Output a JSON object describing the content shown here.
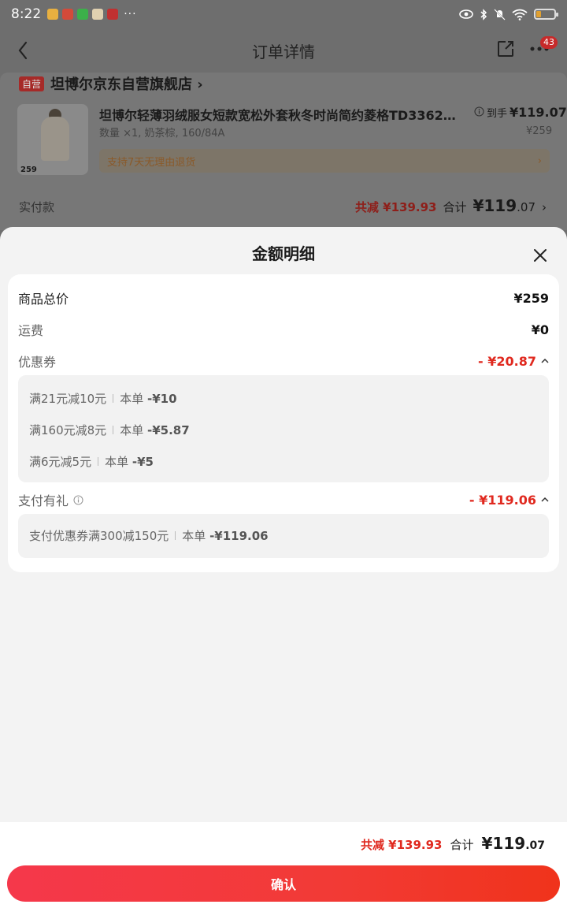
{
  "status_bar": {
    "time": "8:22",
    "more": "···"
  },
  "nav": {
    "title": "订单详情",
    "badge": "43"
  },
  "store": {
    "tag": "自营",
    "name": "坦博尔京东自营旗舰店 ›"
  },
  "product": {
    "title": "坦博尔轻薄羽绒服女短款宽松外套秋冬时尚简约菱格TD336268...",
    "spec": "数量 ×1, 奶茶棕, 160/84A",
    "thumb_price": "259",
    "daoshou_label": "到手",
    "daoshou_price": "¥119.07",
    "original_price": "¥259",
    "return_text": "支持7天无理由退货",
    "return_chevron": "›"
  },
  "paid": {
    "label": "实付款",
    "discount": "共减 ¥139.93",
    "total_label": "合计",
    "total_big": "¥119",
    "total_small": ".07",
    "chevron": "›"
  },
  "sheet": {
    "title": "金额明细",
    "rows": {
      "goods_total": {
        "label": "商品总价",
        "value": "¥259"
      },
      "shipping": {
        "label": "运费",
        "value": "¥0"
      },
      "coupon": {
        "label": "优惠券",
        "value": "- ¥20.87"
      },
      "pay_gift": {
        "label": "支付有礼",
        "value": "- ¥119.06"
      }
    },
    "coupon_items": [
      {
        "name": "满21元减10元",
        "scope": "本单",
        "amount": "-¥10"
      },
      {
        "name": "满160元减8元",
        "scope": "本单",
        "amount": "-¥5.87"
      },
      {
        "name": "满6元减5元",
        "scope": "本单",
        "amount": "-¥5"
      }
    ],
    "pay_gift_items": [
      {
        "name": "支付优惠券满300减150元",
        "scope": "本单",
        "amount": "-¥119.06"
      }
    ]
  },
  "footer": {
    "discount": "共减 ¥139.93",
    "total_label": "合计",
    "total_big": "¥119",
    "total_small": ".07",
    "confirm": "确认"
  },
  "colors": {
    "accent_red": "#e0291f",
    "confirm_gradient_start": "#f5384b",
    "confirm_gradient_end": "#f0331b",
    "sheet_bg": "#f3f3f3"
  }
}
